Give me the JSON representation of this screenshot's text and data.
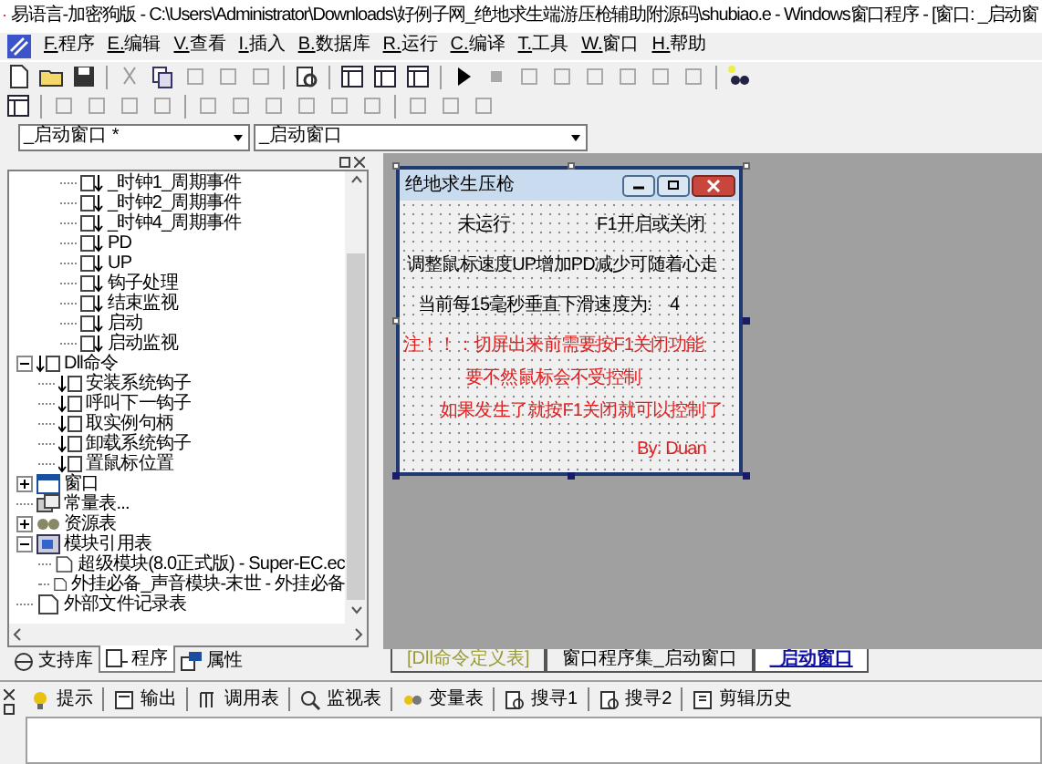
{
  "window": {
    "title": "易语言-加密狗版 - C:\\Users\\Administrator\\Downloads\\好例子网_绝地求生端游压枪辅助附源码\\shubiao.e - Windows窗口程序 - [窗口: _启动窗"
  },
  "menu": [
    "F.程序",
    "E.编辑",
    "V.查看",
    "I.插入",
    "B.数据库",
    "R.运行",
    "C.编译",
    "T.工具",
    "W.窗口",
    "H.帮助"
  ],
  "combos": [
    {
      "value": "_启动窗口 *"
    },
    {
      "value": "_启动窗口"
    }
  ],
  "tree": {
    "partial_children": [
      {
        "label": "_时钟1_周期事件",
        "kind": "sub"
      },
      {
        "label": "_时钟2_周期事件",
        "kind": "sub"
      },
      {
        "label": "_时钟4_周期事件",
        "kind": "sub"
      },
      {
        "label": "PD",
        "kind": "sub"
      },
      {
        "label": "UP",
        "kind": "sub"
      },
      {
        "label": "钩子处理",
        "kind": "sub"
      },
      {
        "label": "结束监视",
        "kind": "sub"
      },
      {
        "label": "启动",
        "kind": "sub"
      },
      {
        "label": "启动监视",
        "kind": "sub"
      }
    ],
    "items": [
      {
        "label": "Dll命令",
        "kind": "dll",
        "expanded": true,
        "children": [
          {
            "label": "安装系统钩子",
            "kind": "dll"
          },
          {
            "label": "呼叫下一钩子",
            "kind": "dll"
          },
          {
            "label": "取实例句柄",
            "kind": "dll"
          },
          {
            "label": "卸载系统钩子",
            "kind": "dll"
          },
          {
            "label": "置鼠标位置",
            "kind": "dll"
          }
        ]
      },
      {
        "label": "窗口",
        "kind": "window",
        "expanded": false
      },
      {
        "label": "常量表...",
        "kind": "const"
      },
      {
        "label": "资源表",
        "kind": "resource",
        "expanded": false
      },
      {
        "label": "模块引用表",
        "kind": "module",
        "expanded": true,
        "children": [
          {
            "label": "超级模块(8.0正式版) - Super-EC.ec",
            "kind": "file"
          },
          {
            "label": "外挂必备_声音模块-末世 - 外挂必备",
            "kind": "file"
          }
        ]
      },
      {
        "label": "外部文件记录表",
        "kind": "file"
      }
    ]
  },
  "left_tabs": [
    {
      "label": "支持库",
      "selected": false
    },
    {
      "label": "程序",
      "selected": true
    },
    {
      "label": "属性",
      "selected": false
    }
  ],
  "form": {
    "title": "绝地求生压枪",
    "labels": [
      {
        "text": "未运行",
        "kind": "text"
      },
      {
        "text": "F1开启或关闭",
        "kind": "text"
      },
      {
        "text": "调整鼠标速度UP增加PD减少可随着心走",
        "kind": "text"
      },
      {
        "text": "当前每15毫秒垂直下滑速度为:",
        "kind": "text"
      },
      {
        "text": "4",
        "kind": "text"
      },
      {
        "text": "注！！：切屏出来前需要按F1关闭功能",
        "kind": "note"
      },
      {
        "text": "要不然鼠标会不受控制",
        "kind": "note"
      },
      {
        "text": "如果发生了就按F1关闭就可以控制了",
        "kind": "note"
      },
      {
        "text": "By: Duan",
        "kind": "note"
      }
    ]
  },
  "editor_tabs": [
    {
      "label": "[Dll命令定义表]",
      "kind": "dll",
      "selected": false
    },
    {
      "label": "窗口程序集_启动窗口",
      "kind": "code",
      "selected": false
    },
    {
      "label": "_启动窗口",
      "kind": "form",
      "selected": true
    }
  ],
  "bottom_tabs": [
    "提示",
    "输出",
    "调用表",
    "监视表",
    "变量表",
    "搜寻1",
    "搜寻2",
    "剪辑历史"
  ]
}
